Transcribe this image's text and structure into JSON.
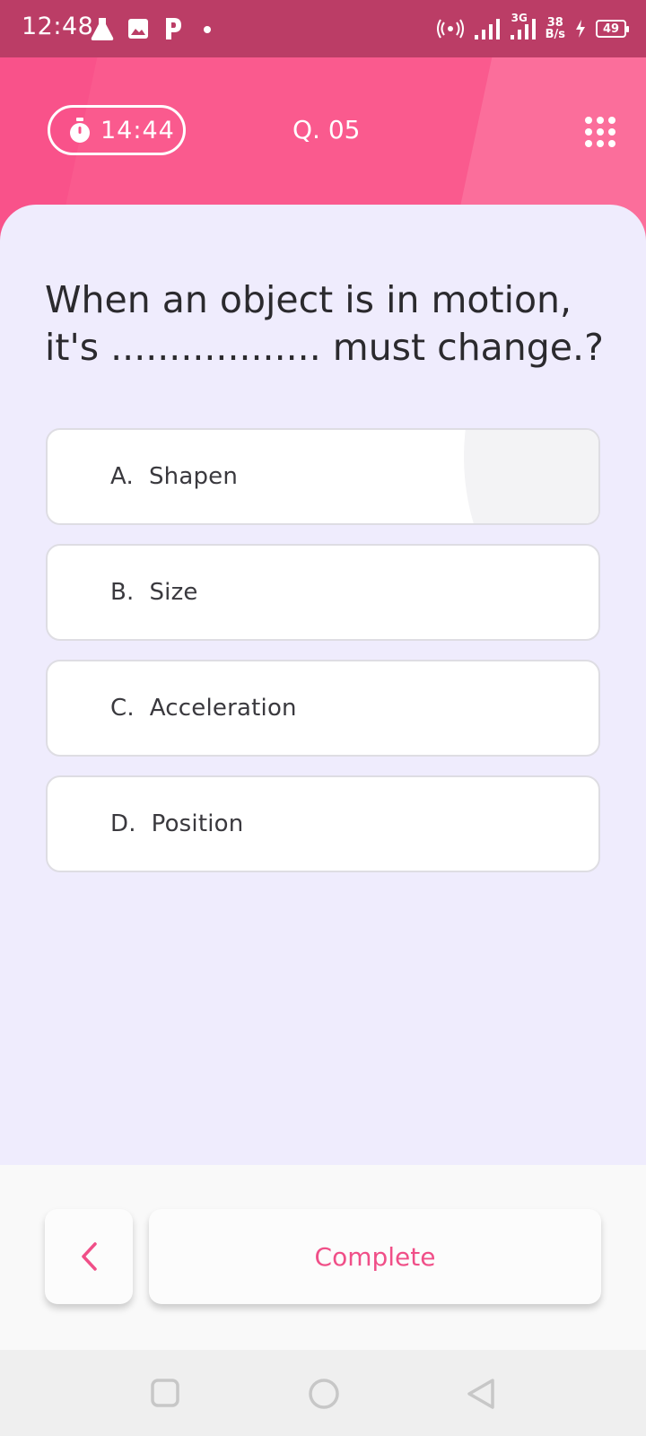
{
  "status_bar": {
    "time": "12:48",
    "network_label": "3G",
    "speed_value": "38",
    "speed_unit": "B/s",
    "battery": "49"
  },
  "header": {
    "timer": "14:44",
    "question_number": "Q. 05",
    "accent_color": "#f9528a"
  },
  "question": {
    "line1": "When an object is in motion,",
    "line2": "it's .................. must change.?"
  },
  "options": [
    {
      "label": "A.",
      "text": "Shapen"
    },
    {
      "label": "B.",
      "text": "Size"
    },
    {
      "label": "C.",
      "text": "Acceleration"
    },
    {
      "label": "D.",
      "text": "Position"
    }
  ],
  "footer": {
    "complete_label": "Complete"
  },
  "icons": {
    "timer": "stopwatch-icon",
    "grid": "grid-menu-icon",
    "back": "chevron-left-icon"
  }
}
